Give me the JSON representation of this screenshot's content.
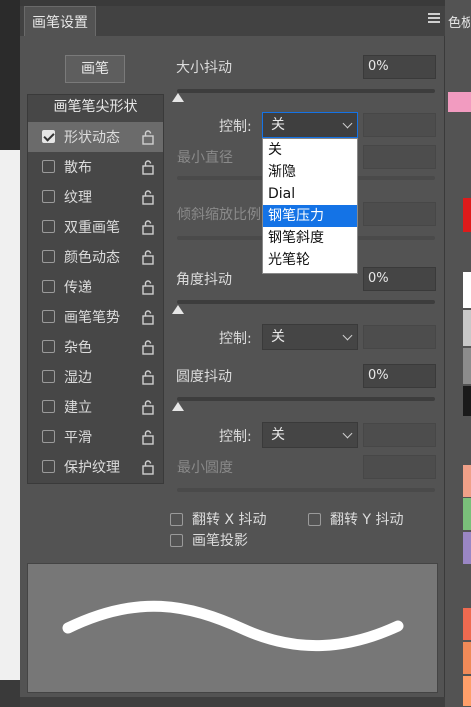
{
  "panel": {
    "tab_label": "画笔设置",
    "brush_button": "画笔",
    "right_tab_label": "色板"
  },
  "settings": {
    "header": "画笔笔尖形状",
    "items": [
      {
        "label": "形状动态",
        "checked": true,
        "active": true
      },
      {
        "label": "散布",
        "checked": false,
        "active": false
      },
      {
        "label": "纹理",
        "checked": false,
        "active": false
      },
      {
        "label": "双重画笔",
        "checked": false,
        "active": false
      },
      {
        "label": "颜色动态",
        "checked": false,
        "active": false
      },
      {
        "label": "传递",
        "checked": false,
        "active": false
      },
      {
        "label": "画笔笔势",
        "checked": false,
        "active": false
      },
      {
        "label": "杂色",
        "checked": false,
        "active": false
      },
      {
        "label": "湿边",
        "checked": false,
        "active": false
      },
      {
        "label": "建立",
        "checked": false,
        "active": false
      },
      {
        "label": "平滑",
        "checked": false,
        "active": false
      },
      {
        "label": "保护纹理",
        "checked": false,
        "active": false
      }
    ]
  },
  "controls": {
    "size_jitter_label": "大小抖动",
    "size_jitter_value": "0%",
    "control_label": "控制:",
    "control1_value": "关",
    "min_diameter_label": "最小直径",
    "tilt_scale_label": "倾斜缩放比例",
    "angle_jitter_label": "角度抖动",
    "angle_jitter_value": "0%",
    "control2_value": "关",
    "roundness_jitter_label": "圆度抖动",
    "roundness_jitter_value": "0%",
    "control3_value": "关",
    "min_roundness_label": "最小圆度",
    "flip_x_label": "翻转 X 抖动",
    "flip_y_label": "翻转 Y 抖动",
    "brush_projection_label": "画笔投影"
  },
  "dropdown_menu": {
    "options": [
      "关",
      "渐隐",
      "Dial",
      "钢笔压力",
      "钢笔斜度",
      "光笔轮"
    ],
    "selected": "钢笔压力"
  },
  "colors": {
    "accent": "#1473e6",
    "swatches": [
      "#f29bc0",
      "#dd1b1b",
      "#ffffff",
      "#c8c8c8",
      "#8c8c8c",
      "#1a1a1a",
      "#f0a088",
      "#7ac07a",
      "#9a86c4",
      "#ef6a50",
      "#f08a58",
      "#ff9f6a"
    ]
  }
}
